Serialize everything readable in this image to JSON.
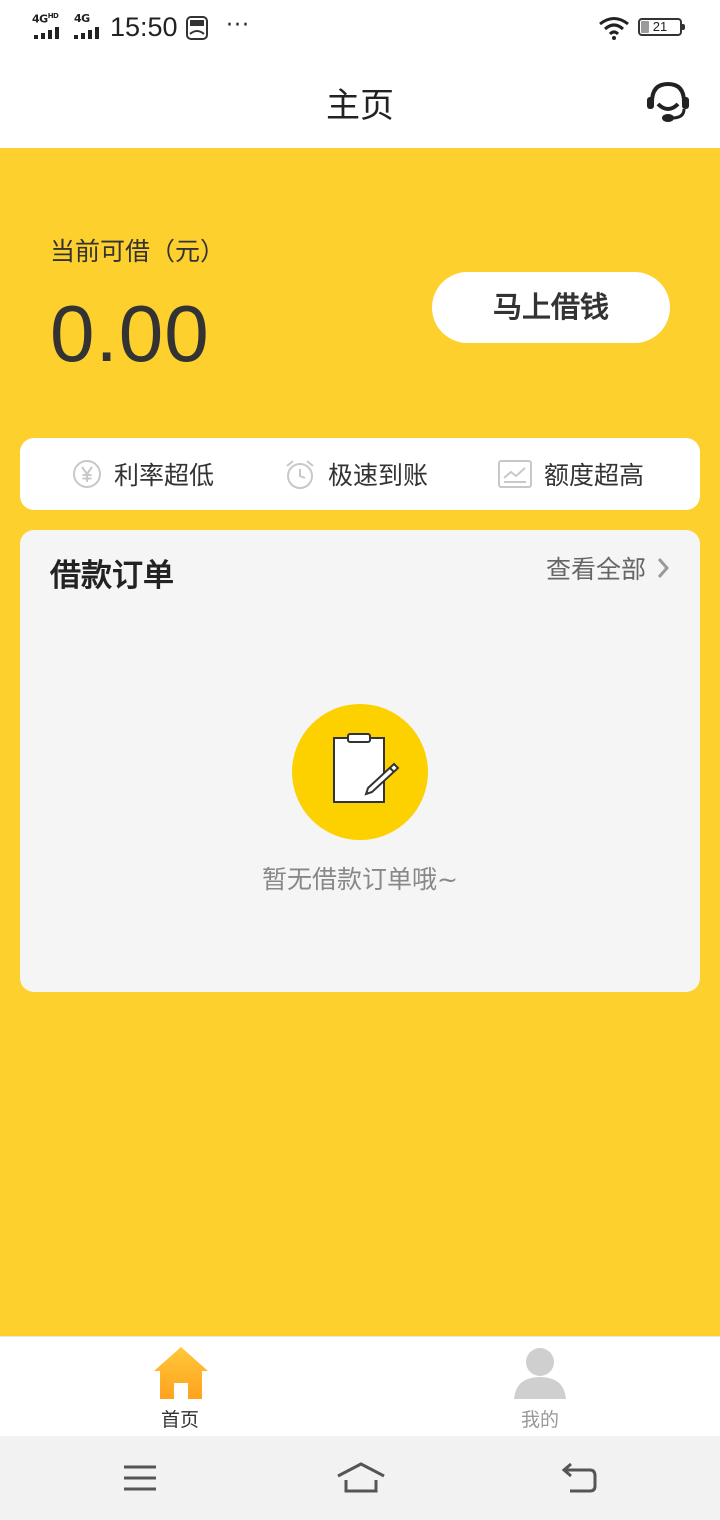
{
  "status_bar": {
    "network_1": "4G",
    "network_1_suffix": "HD",
    "network_2": "4G",
    "time": "15:50",
    "more": "···",
    "battery": "21"
  },
  "header": {
    "title": "主页"
  },
  "loan": {
    "label": "当前可借（元）",
    "amount": "0.00",
    "button_label": "马上借钱"
  },
  "features": [
    {
      "icon": "yen-icon",
      "label": "利率超低"
    },
    {
      "icon": "alarm-clock-icon",
      "label": "极速到账"
    },
    {
      "icon": "chart-icon",
      "label": "额度超高"
    }
  ],
  "orders": {
    "title": "借款订单",
    "view_all": "查看全部",
    "empty_text": "暂无借款订单哦~"
  },
  "tabs": [
    {
      "label": "首页",
      "active": true
    },
    {
      "label": "我的",
      "active": false
    }
  ],
  "colors": {
    "accent": "#FDD02E",
    "empty_circle": "#FDD000",
    "tab_active": "#333333",
    "tab_inactive": "#999999"
  }
}
